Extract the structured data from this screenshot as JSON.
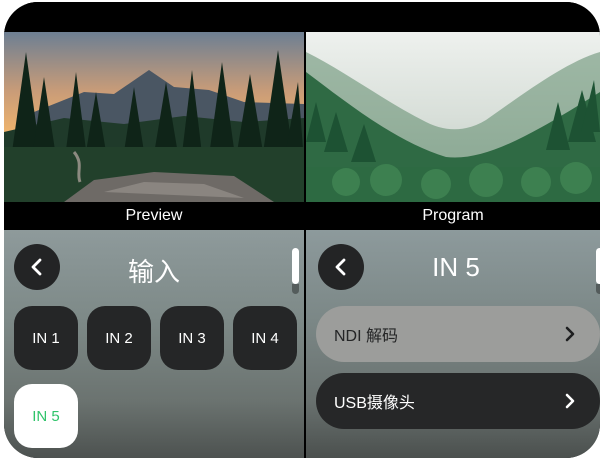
{
  "monitors": {
    "preview": {
      "label": "Preview"
    },
    "program": {
      "label": "Program"
    }
  },
  "left_panel": {
    "title": "输入",
    "inputs": [
      "IN 1",
      "IN 2",
      "IN 3",
      "IN 4",
      "IN 5"
    ],
    "selected_input": "IN 5"
  },
  "right_panel": {
    "title": "IN 5",
    "rows": [
      {
        "label": "NDI 解码"
      },
      {
        "label": "USB摄像头"
      }
    ]
  },
  "colors": {
    "button_dark": "#252627",
    "selected_bg": "#ffffff",
    "selected_text": "#2fc46a",
    "row_light": "#9c9d9b",
    "row_dark": "#262728"
  },
  "icons": [
    "back-chevron-icon",
    "chevron-right-icon"
  ]
}
